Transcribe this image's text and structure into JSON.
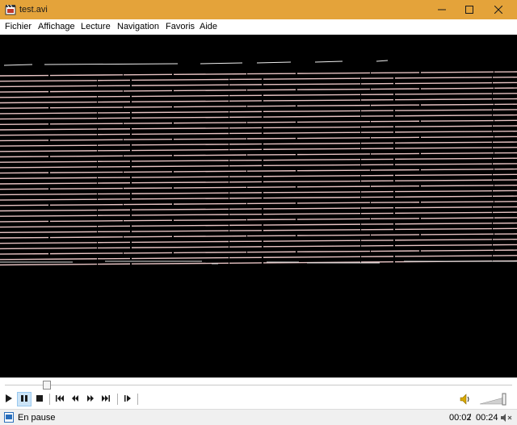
{
  "window": {
    "title": "test.avi",
    "accent": "#e4a33a",
    "icons": [
      "film-icon",
      "minimize-icon",
      "maximize-icon",
      "close-icon"
    ]
  },
  "menu": {
    "items": [
      "Fichier",
      "Affichage",
      "Lecture",
      "Navigation",
      "Favoris",
      "Aide"
    ]
  },
  "video": {
    "content": "horizontal striped frame",
    "stripe_color": "#e8c4c4"
  },
  "seek": {
    "position_seconds": 2,
    "duration_seconds": 24
  },
  "controls": {
    "icons": [
      "play-icon",
      "pause-icon",
      "stop-icon",
      "skip-back-icon",
      "rewind-icon",
      "fast-forward-icon",
      "skip-forward-icon",
      "frame-step-icon",
      "volume-icon"
    ],
    "pause_active": true,
    "volume_level": 1.0
  },
  "status": {
    "text": "En pause",
    "time_current": "00:02",
    "time_separator": "/",
    "time_total": "00:24",
    "icons": [
      "status-file-icon",
      "mute-icon"
    ]
  }
}
